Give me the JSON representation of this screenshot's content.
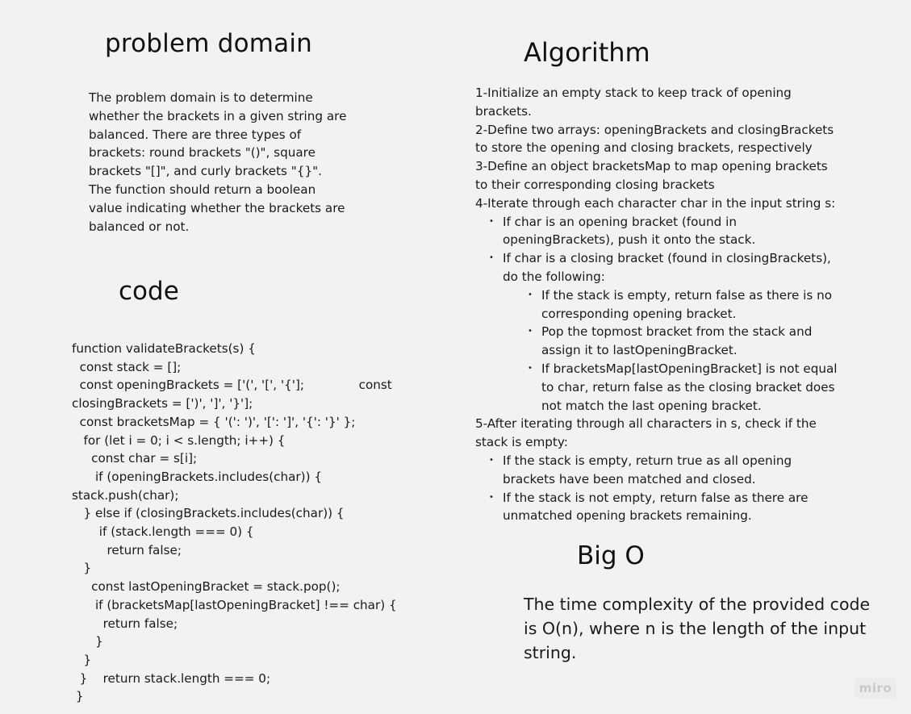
{
  "problem": {
    "title": "problem domain",
    "body": "The problem domain is to determine whether the brackets in a given string are balanced. There are three types of brackets: round brackets \"()\", square brackets \"[]\", and curly brackets \"{}\". The function should return a boolean value indicating whether the brackets are balanced or not."
  },
  "code": {
    "title": "code",
    "lines": [
      "function validateBrackets(s) {",
      "  const stack = [];",
      "  const openingBrackets = ['(', '[', '{'];              const",
      "closingBrackets = [')', ']', '}'];",
      "  const bracketsMap = { '(': ')', '[': ']', '{': '}' };",
      "   for (let i = 0; i < s.length; i++) {",
      "     const char = s[i];",
      "      if (openingBrackets.includes(char)) {",
      "stack.push(char);",
      "   } else if (closingBrackets.includes(char)) {",
      "       if (stack.length === 0) {",
      "         return false;",
      "   }",
      "     const lastOpeningBracket = stack.pop();",
      "      if (bracketsMap[lastOpeningBracket] !== char) {",
      "        return false;",
      "      }",
      "   }",
      "  }    return stack.length === 0;",
      " }"
    ]
  },
  "algorithm": {
    "title": "Algorithm",
    "bullet_glyph": "•",
    "step1": "1-Initialize an empty stack to keep track of opening brackets.",
    "step2": "2-Define two arrays: openingBrackets and closingBrackets to store the opening and closing brackets, respectively",
    "step3": "3-Define an object bracketsMap to map opening brackets to their corresponding closing brackets",
    "step4": "4-Iterate through each character char in the input string s:",
    "step4_a": "If char is an opening bracket (found in openingBrackets), push it onto the stack.",
    "step4_b": "If char is a closing bracket (found in closingBrackets), do the following:",
    "step4_b1": "If the stack is empty, return false as there is no corresponding opening bracket.",
    "step4_b2": "Pop the topmost bracket from the stack and assign it to lastOpeningBracket.",
    "step4_b3": "If bracketsMap[lastOpeningBracket] is not equal to char, return false as the closing bracket does not match the last opening bracket.",
    "step5": "5-After iterating through all characters in s, check if the stack is empty:",
    "step5_a": "If the stack is empty, return true as all opening brackets have been matched and closed.",
    "step5_b": "If the stack is not empty, return false as there are unmatched opening brackets remaining."
  },
  "bigo": {
    "title": "Big O",
    "body": "The time complexity of the provided code is O(n), where n is the length of the input string."
  },
  "watermark": "miro"
}
